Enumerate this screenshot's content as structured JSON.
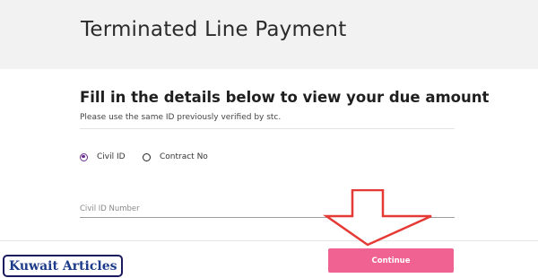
{
  "header": {
    "title": "Terminated Line Payment"
  },
  "form": {
    "heading": "Fill in the details below to view your due amount",
    "note": "Please use the same ID previously verified by stc.",
    "id_type_options": [
      {
        "label": "Civil ID",
        "selected": true
      },
      {
        "label": "Contract No",
        "selected": false
      }
    ],
    "id_input": {
      "placeholder": "Civil ID Number",
      "value": ""
    },
    "continue_label": "Continue"
  },
  "watermark": {
    "text": "Kuwait Articles"
  },
  "colors": {
    "header_band": "#f2f2f2",
    "accent_purple": "#6b2c8f",
    "button_pink": "#f06292",
    "annotation_red": "#e53935",
    "watermark_blue": "#1d3b8b"
  }
}
